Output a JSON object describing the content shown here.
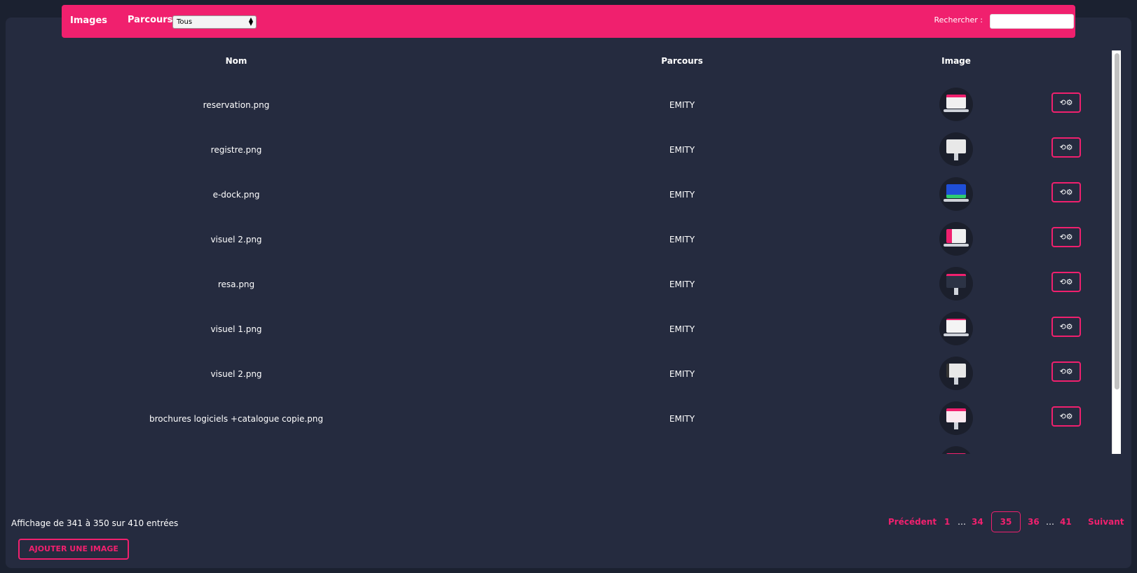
{
  "header": {
    "title": "Images",
    "parcours_label": "Parcours",
    "parcours_selected": "Tous",
    "search_label": "Rechercher :",
    "search_value": ""
  },
  "table": {
    "columns": [
      "Nom",
      "Parcours",
      "Image"
    ],
    "rows": [
      {
        "name": "reservation.png",
        "parcours": "EMITY",
        "thumb": "laptop-pink"
      },
      {
        "name": "registre.png",
        "parcours": "EMITY",
        "thumb": "monitor-white"
      },
      {
        "name": "e-dock.png",
        "parcours": "EMITY",
        "thumb": "device-blue"
      },
      {
        "name": "visuel 2.png",
        "parcours": "EMITY",
        "thumb": "laptop-pink"
      },
      {
        "name": "resa.png",
        "parcours": "EMITY",
        "thumb": "monitor-dark"
      },
      {
        "name": "visuel 1.png",
        "parcours": "EMITY",
        "thumb": "laptop-white"
      },
      {
        "name": "visuel 2.png",
        "parcours": "EMITY",
        "thumb": "monitor-white"
      },
      {
        "name": "brochures logiciels +catalogue copie.png",
        "parcours": "EMITY",
        "thumb": "monitor-pink"
      }
    ],
    "action_icon": "replace-settings-icon",
    "action_glyph": "⟲⚙"
  },
  "footer": {
    "info": "Affichage de 341 à 350 sur 410 entrées",
    "pagination": {
      "prev": "Précédent",
      "pages": [
        "1",
        "…",
        "34",
        "35",
        "36",
        "…",
        "41"
      ],
      "current": "35",
      "next": "Suivant"
    },
    "add_button": "AJOUTER UNE IMAGE"
  },
  "colors": {
    "accent": "#f0206e",
    "panel": "#252b3f",
    "background": "#1b2130"
  }
}
